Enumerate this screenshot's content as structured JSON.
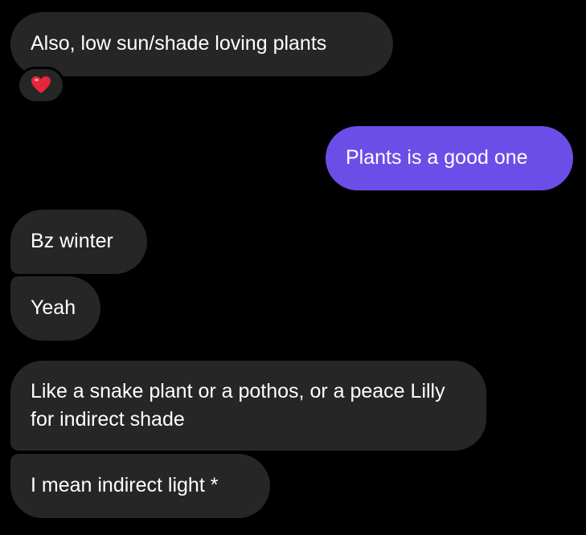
{
  "conversation": {
    "messages": [
      {
        "direction": "incoming",
        "text": "Also, low sun/shade loving plants",
        "reaction": "heart-icon"
      },
      {
        "direction": "outgoing",
        "text": "Plants is a good one"
      },
      {
        "direction": "incoming",
        "text": "Bz winter"
      },
      {
        "direction": "incoming",
        "text": "Yeah"
      },
      {
        "direction": "incoming",
        "text": "Like a snake plant or a pothos, or a peace Lilly for indirect shade"
      },
      {
        "direction": "incoming",
        "text": "I mean indirect light *"
      }
    ]
  },
  "colors": {
    "background": "#000000",
    "incoming_bubble": "#262626",
    "outgoing_bubble": "#6b4ee8",
    "text": "#ffffff",
    "heart": "#e8253b"
  }
}
